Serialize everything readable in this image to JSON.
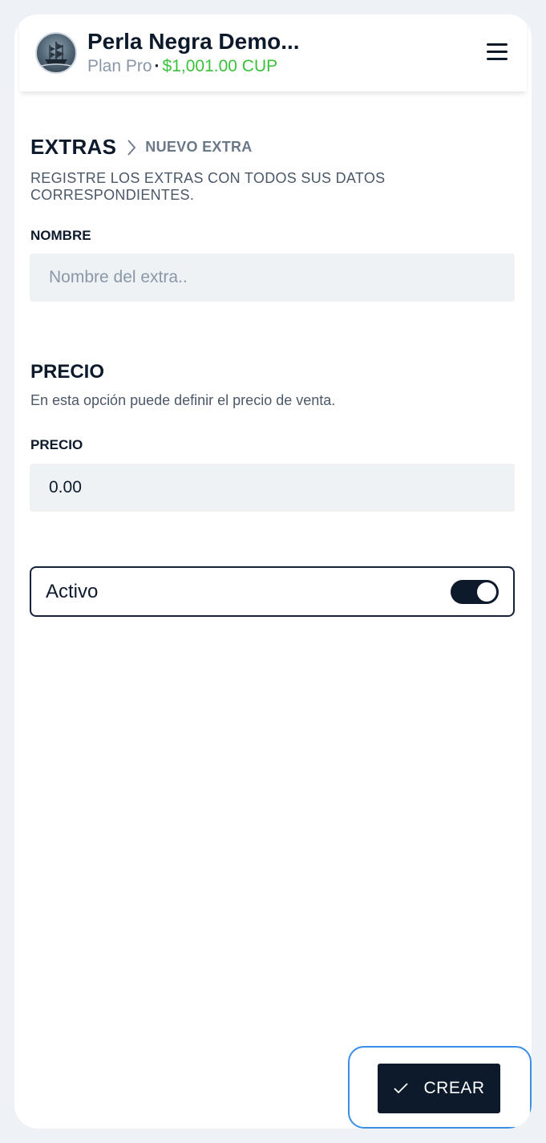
{
  "header": {
    "store_name": "Perla Negra Demo...",
    "plan": "Plan Pro",
    "separator": "·",
    "balance": "$1,001.00 CUP",
    "menu_icon": "hamburger-menu-icon"
  },
  "breadcrumb": {
    "section": "EXTRAS",
    "separator_icon": "chevron-right-icon",
    "current": "NUEVO EXTRA"
  },
  "subtitle": "REGISTRE LOS EXTRAS CON TODOS SUS DATOS CORRESPONDIENTES.",
  "form": {
    "name_label": "NOMBRE",
    "name_placeholder": "Nombre del extra..",
    "name_value": "",
    "price_section_title": "PRECIO",
    "price_section_desc": "En esta opción puede definir el precio de venta.",
    "price_label": "PRECIO",
    "price_value": "0.00",
    "active_label": "Activo",
    "active_on": true
  },
  "actions": {
    "create_label": "CREAR",
    "create_icon": "check-icon"
  },
  "colors": {
    "primary": "#0d1a2c",
    "balance_green": "#3ac23a",
    "focus_ring": "#3a8ee6",
    "input_bg": "#eef2f5"
  }
}
